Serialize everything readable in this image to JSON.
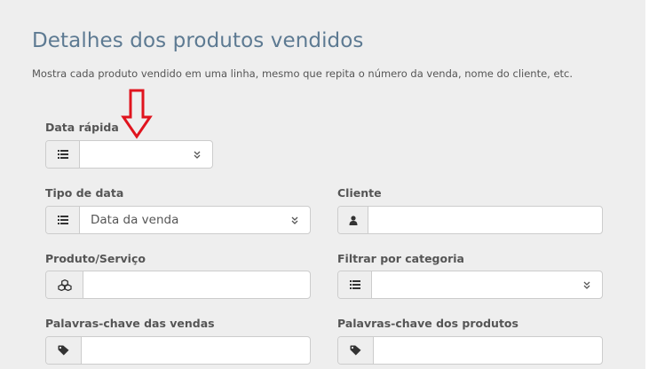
{
  "page": {
    "title": "Detalhes dos produtos vendidos",
    "subtitle": "Mostra cada produto vendido em uma linha, mesmo que repita o número da venda, nome do cliente, etc."
  },
  "filters": {
    "quick_date": {
      "label": "Data rápida",
      "value": "",
      "icon": "list-icon"
    },
    "date_type": {
      "label": "Tipo de data",
      "value": "Data da venda",
      "icon": "list-icon"
    },
    "client": {
      "label": "Cliente",
      "value": "",
      "icon": "user-icon"
    },
    "product_service": {
      "label": "Produto/Serviço",
      "value": "",
      "icon": "cubes-icon"
    },
    "category": {
      "label": "Filtrar por categoria",
      "value": "",
      "icon": "list-icon"
    },
    "sales_keywords": {
      "label": "Palavras-chave das vendas",
      "value": "",
      "icon": "tag-icon"
    },
    "product_keywords": {
      "label": "Palavras-chave dos produtos",
      "value": "",
      "icon": "tag-icon"
    }
  },
  "colors": {
    "title": "#5d7a92",
    "annotation_arrow": "#e0141e",
    "panel_background": "#eeeeee"
  }
}
